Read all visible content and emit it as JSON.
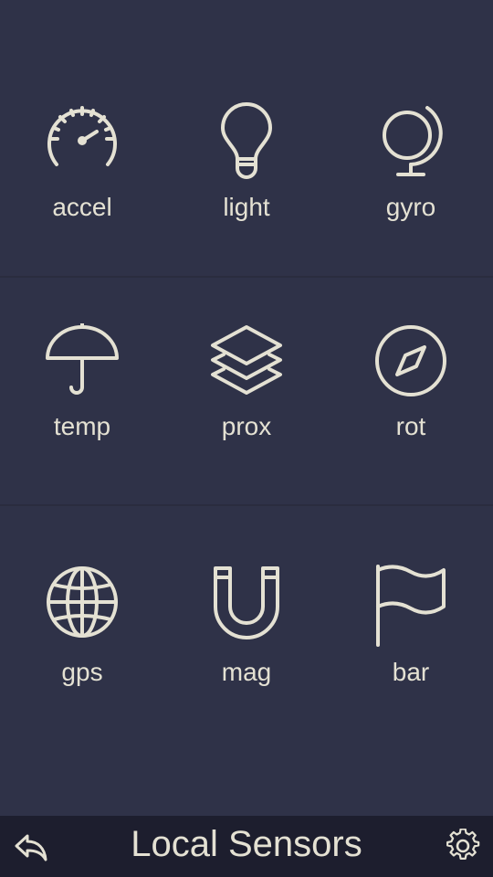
{
  "sensors": [
    {
      "label": "accel",
      "icon": "speedometer-icon"
    },
    {
      "label": "light",
      "icon": "lightbulb-icon"
    },
    {
      "label": "gyro",
      "icon": "globe-stand-icon"
    },
    {
      "label": "temp",
      "icon": "umbrella-icon"
    },
    {
      "label": "prox",
      "icon": "layers-icon"
    },
    {
      "label": "rot",
      "icon": "compass-icon"
    },
    {
      "label": "gps",
      "icon": "globe-icon"
    },
    {
      "label": "mag",
      "icon": "magnet-icon"
    },
    {
      "label": "bar",
      "icon": "flag-icon"
    }
  ],
  "bottom_bar": {
    "title": "Local Sensors",
    "back_icon": "reply-icon",
    "settings_icon": "gear-icon"
  },
  "colors": {
    "background": "#2f3248",
    "bottom_bar": "#1d1e2e",
    "foreground": "#e4e1d3"
  }
}
